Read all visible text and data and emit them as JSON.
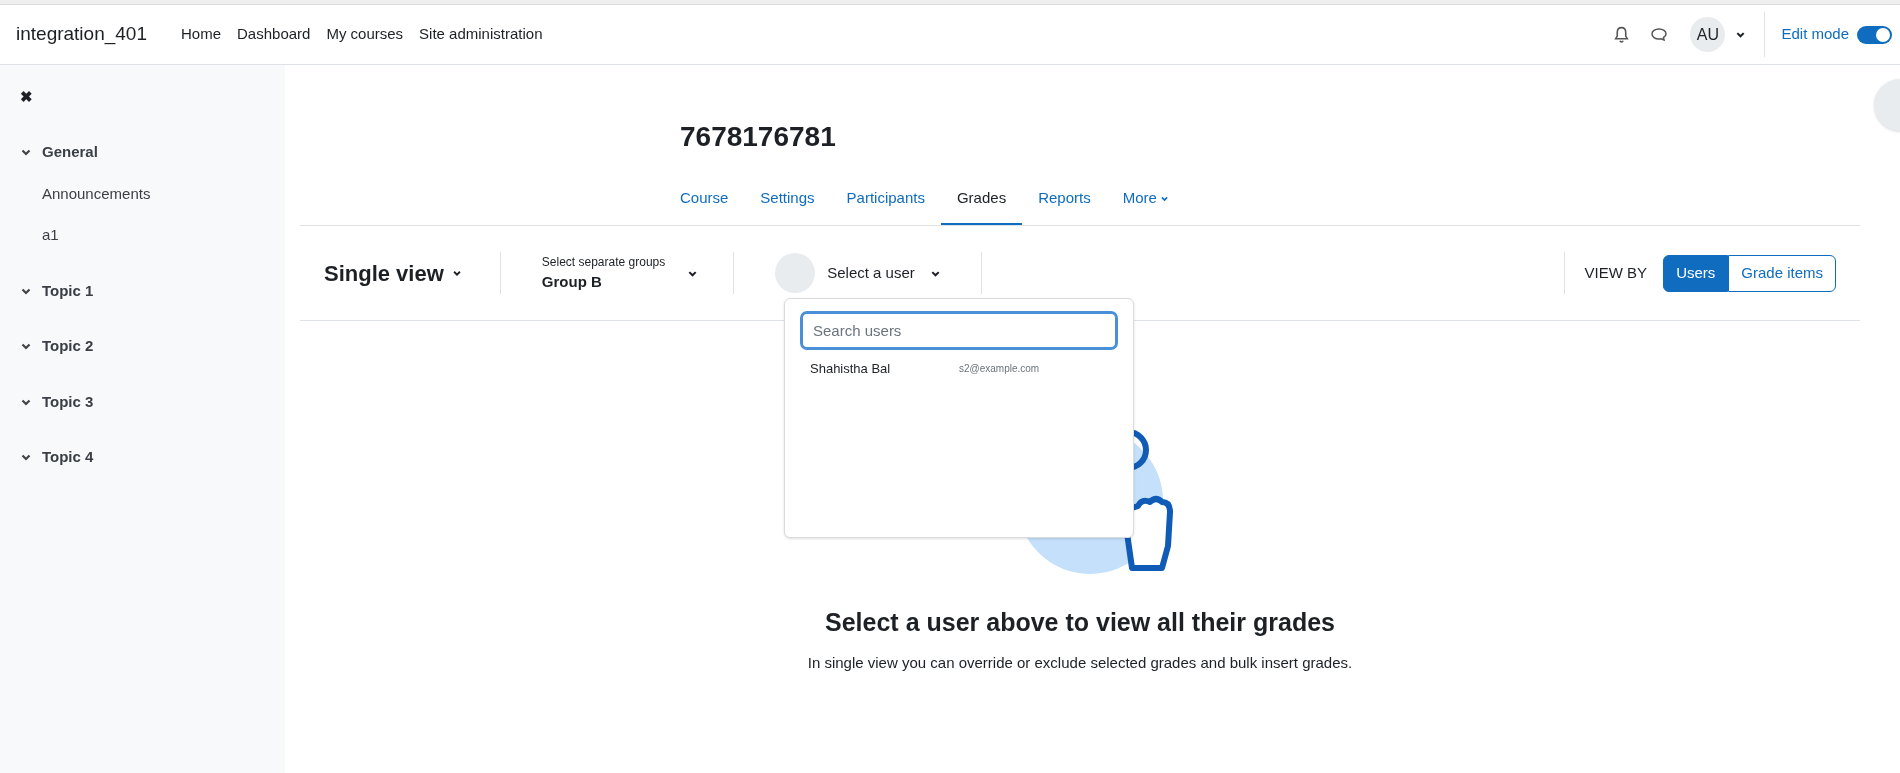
{
  "header": {
    "site_name": "integration_401",
    "nav": [
      "Home",
      "Dashboard",
      "My courses",
      "Site administration"
    ],
    "avatar": "AU",
    "edit_mode": {
      "label": "Edit mode",
      "on": true
    }
  },
  "sidebar": {
    "close": "✖",
    "sections": [
      {
        "title": "General",
        "expanded": true,
        "children": [
          "Announcements",
          "a1"
        ]
      },
      {
        "title": "Topic 1",
        "expanded": true
      },
      {
        "title": "Topic 2",
        "expanded": true
      },
      {
        "title": "Topic 3",
        "expanded": true
      },
      {
        "title": "Topic 4",
        "expanded": true
      }
    ]
  },
  "course": {
    "title": "7678176781",
    "tabs": [
      {
        "label": "Course",
        "selected": false
      },
      {
        "label": "Settings",
        "selected": false
      },
      {
        "label": "Participants",
        "selected": false
      },
      {
        "label": "Grades",
        "selected": true
      },
      {
        "label": "Reports",
        "selected": false
      },
      {
        "label": "More",
        "selected": false,
        "kind": "menu"
      }
    ]
  },
  "toolbar": {
    "report": "Single view",
    "group_label": "Select separate groups",
    "group_value": "Group B",
    "user_select": "Select a user",
    "view_by_label": "VIEW BY",
    "view_by": [
      {
        "label": "Users",
        "selected": true
      },
      {
        "label": "Grade items",
        "selected": false
      }
    ]
  },
  "user_dropdown": {
    "search": {
      "placeholder": "Search users"
    },
    "users": [
      {
        "name": "Shahistha Bal",
        "email": "s2@example.com"
      }
    ]
  },
  "empty_state": {
    "title": "Select a user above to view all their grades",
    "text": "In single view you can override or exclude selected grades and bulk insert grades."
  }
}
